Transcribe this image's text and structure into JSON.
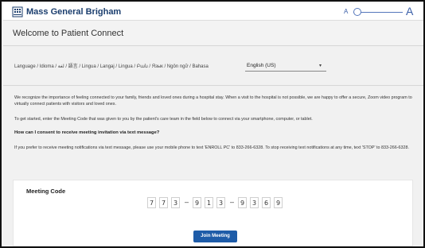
{
  "header": {
    "brand": "Mass General Brigham",
    "font_small_label": "A",
    "font_large_label": "A",
    "logo_icon": "building-icon",
    "accent_color": "#1b3e6e"
  },
  "welcome": {
    "title": "Welcome to Patient Connect"
  },
  "language": {
    "label": "Language / Idioma / ﻟﻐﺔ / 語言 / Lingua / Langaj / Lingua / Բան / Язык / Ngôn ngữ / Bahasa",
    "selected": "English (US)"
  },
  "info": {
    "p1": "We recognize the importance of feeling connected to your family, friends and loved ones during a hospital stay. When a visit to the hospital is not possible, we are happy to offer a secure, Zoom video program to virtually connect patients with visitors and loved ones.",
    "p2": "To get started, enter the Meeting Code that was given to you by the patient's care team in the field below to connect via your smartphone, computer, or tablet.",
    "p3": "How can I consent to receive meeting invitation via text message?",
    "p4": "If you prefer to receive meeting notifications via text message, please use your mobile phone to text 'ENROLL PC' to 833-266-6328. To stop receiving text notifications at any time, text 'STOP' to 833-266-6328."
  },
  "meeting": {
    "label": "Meeting Code",
    "digits": [
      "7",
      "7",
      "3",
      "9",
      "1",
      "3",
      "9",
      "3",
      "6",
      "9"
    ],
    "separator": "–",
    "join_label": "Join Meeting",
    "button_color": "#1e5ca8"
  }
}
